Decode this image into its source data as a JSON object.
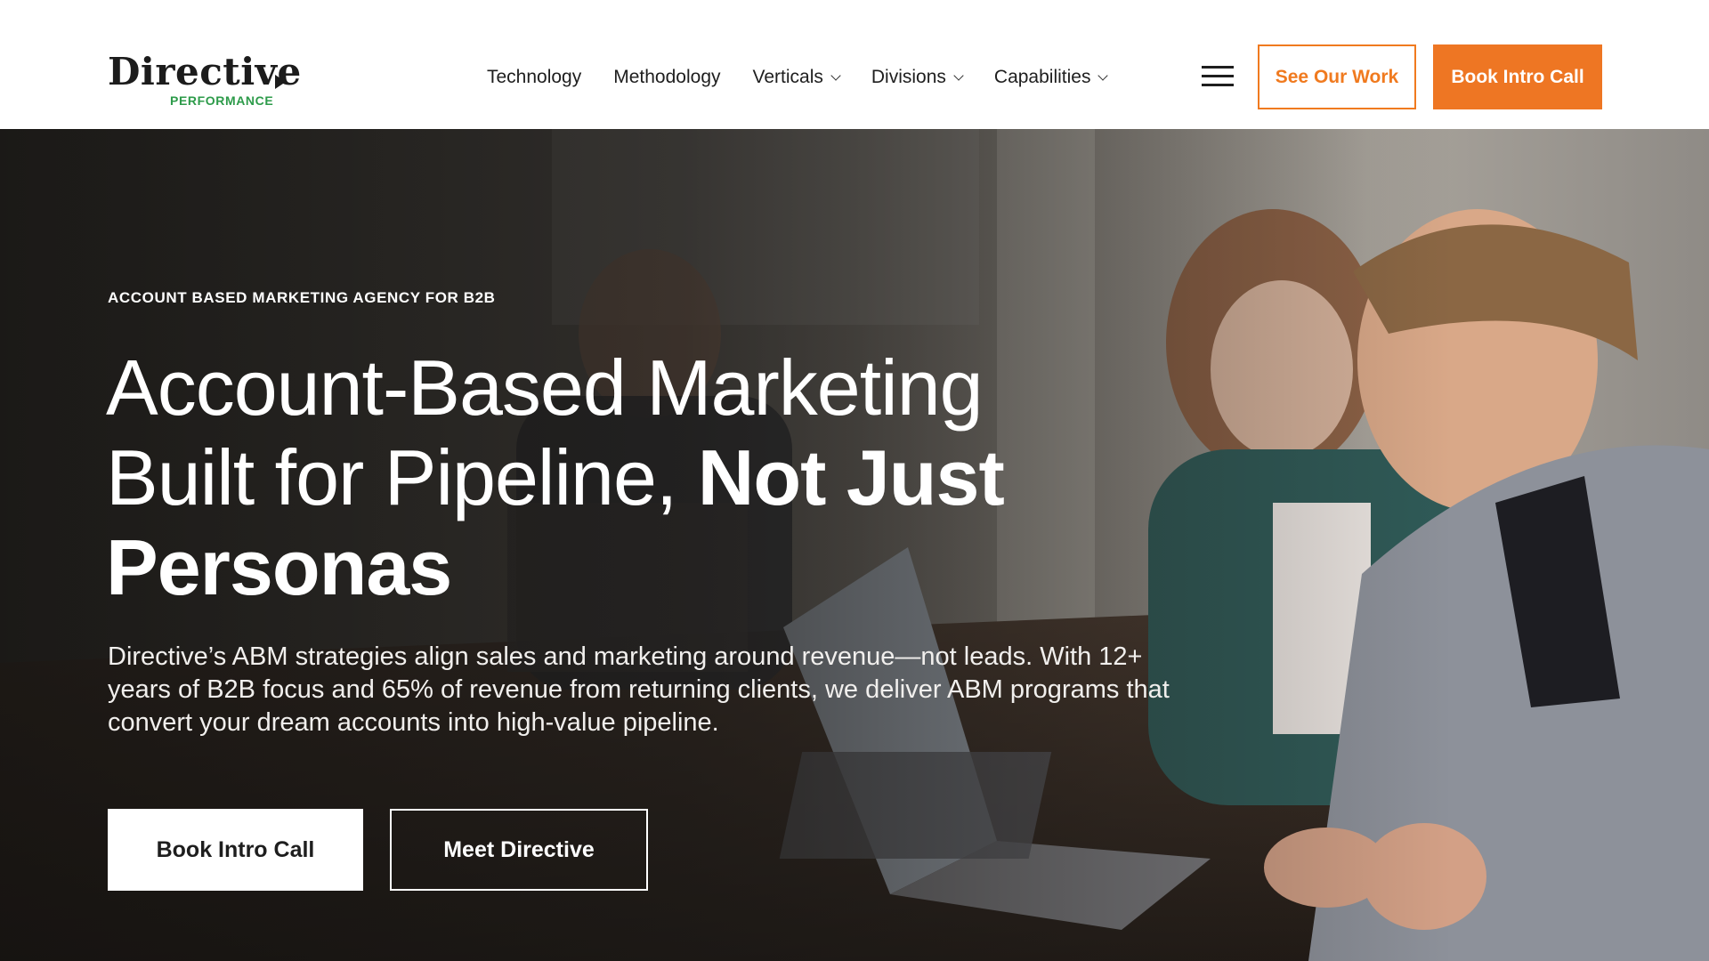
{
  "brand": {
    "logo_word": "Directive",
    "logo_sub": "PERFORMANCE"
  },
  "nav": {
    "items": [
      {
        "label": "Technology",
        "has_dropdown": false
      },
      {
        "label": "Methodology",
        "has_dropdown": false
      },
      {
        "label": "Verticals",
        "has_dropdown": true
      },
      {
        "label": "Divisions",
        "has_dropdown": true
      },
      {
        "label": "Capabilities",
        "has_dropdown": true
      }
    ],
    "menu_icon": "hamburger-menu-icon",
    "see_our_work": "See Our Work",
    "book_intro_call": "Book Intro Call"
  },
  "hero": {
    "eyebrow": "ACCOUNT BASED MARKETING AGENCY FOR B2B",
    "headline_regular": "Account-Based Marketing Built for Pipeline,",
    "headline_bold_1": "Not Just",
    "headline_bold_2": "Personas",
    "lede": "Directive’s ABM strategies align sales and marketing around revenue—not leads. With 12+ years of B2B focus and 65% of revenue from returning clients, we deliver ABM programs that convert your dream accounts into high-value pipeline.",
    "primary_cta": "Book Intro Call",
    "secondary_cta": "Meet Directive"
  },
  "colors": {
    "accent_orange": "#ee7623",
    "logo_green": "#2d9b4a",
    "text_dark": "#1e1e1e"
  }
}
